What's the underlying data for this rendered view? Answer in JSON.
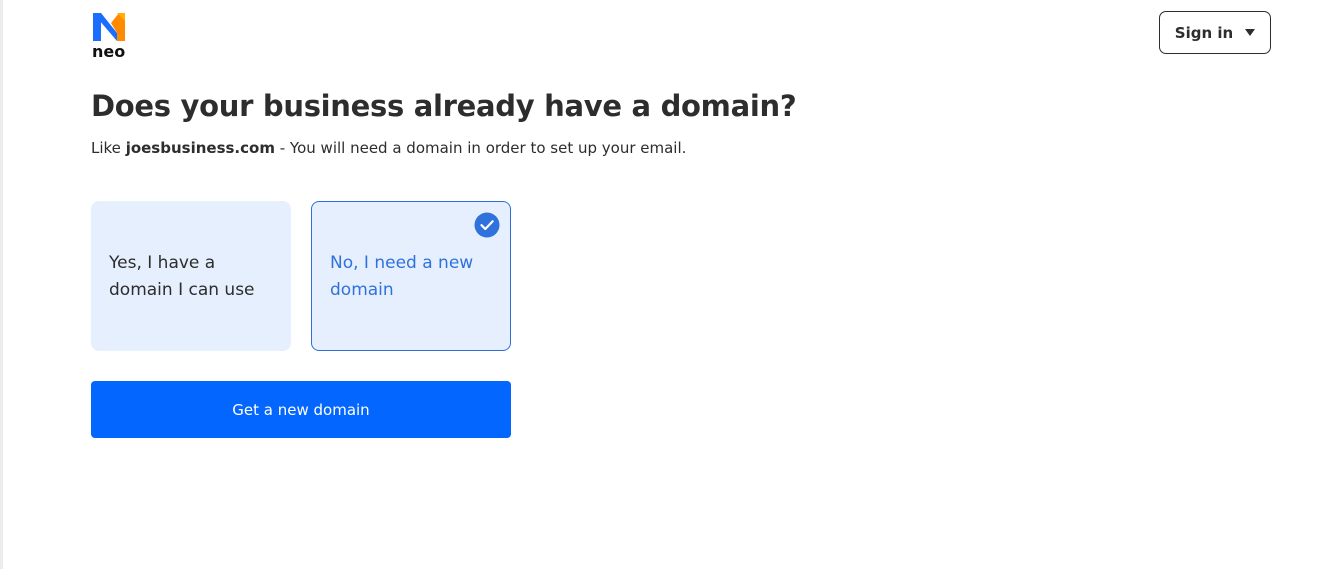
{
  "brand": {
    "name": "neo",
    "colors": {
      "blue": "#1a6dff",
      "orange": "#ff8a00"
    }
  },
  "header": {
    "signin_label": "Sign in",
    "signin_icon": "caret-down-icon"
  },
  "main": {
    "title": "Does your business already have a domain?",
    "subtitle_prefix": "Like",
    "subtitle_domain": "joesbusiness.com",
    "subtitle_suffix": "- You will need a domain in order to set up your email.",
    "options": [
      {
        "label_line1": "Yes, I have a",
        "label_line2": "domain I can use",
        "selected": false
      },
      {
        "label_line1": "No, I need a new",
        "label_line2": "domain",
        "selected": true,
        "icon": "checkmark-circle-icon"
      }
    ],
    "cta_label": "Get a new domain"
  },
  "colors": {
    "accent": "#0366ff",
    "selected_text": "#2f72dc",
    "card_bg": "#e6effd",
    "text": "#2d2d2d"
  }
}
